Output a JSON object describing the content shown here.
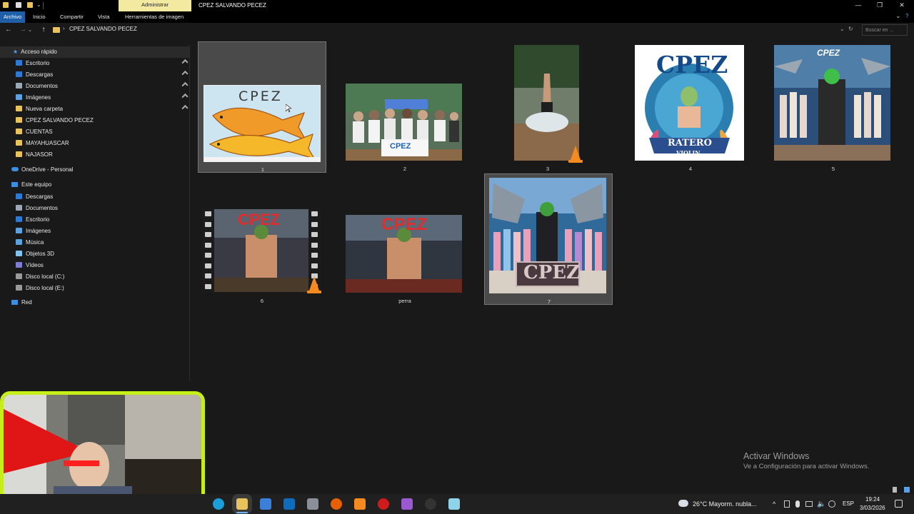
{
  "titlebar": {
    "contextual_tab": "Administrar",
    "window_title": "CPEZ SALVANDO PECEZ",
    "minimize": "—",
    "maximize": "❐",
    "close": "✕"
  },
  "ribbon": {
    "tabs": [
      {
        "label": "Archivo",
        "active": true
      },
      {
        "label": "Inicio"
      },
      {
        "label": "Compartir"
      },
      {
        "label": "Vista"
      },
      {
        "label": "Herramientas de imagen"
      }
    ],
    "expand": "⌄",
    "help": "?"
  },
  "addressbar": {
    "back": "←",
    "forward": "→",
    "recent": "⌄",
    "up": "↑",
    "chevron": "›",
    "path": "CPEZ SALVANDO PECEZ",
    "dropdown": "⌄",
    "refresh": "↻",
    "search_placeholder": "Buscar en ..."
  },
  "sidebar": {
    "quick_access": "Acceso rápido",
    "quick_items": [
      {
        "label": "Escritorio",
        "pinned": true,
        "color": "#2b7bd6"
      },
      {
        "label": "Descargas",
        "pinned": true,
        "color": "#2b7bd6"
      },
      {
        "label": "Documentos",
        "pinned": true,
        "color": "#9aa8b8"
      },
      {
        "label": "Imágenes",
        "pinned": true,
        "color": "#5ba3e0"
      },
      {
        "label": "Nueva carpeta",
        "pinned": true,
        "color": "#e8c25a"
      },
      {
        "label": "CPEZ SALVANDO PECEZ",
        "color": "#e8c25a"
      },
      {
        "label": "CUENTAS",
        "color": "#e8c25a"
      },
      {
        "label": "MAYAHUASCAR",
        "color": "#e8c25a"
      },
      {
        "label": "NAJASOR",
        "color": "#e8c25a"
      }
    ],
    "pin_glyph": "📌",
    "onedrive": "OneDrive - Personal",
    "this_pc": "Este equipo",
    "pc_items": [
      {
        "label": "Descargas",
        "color": "#2b7bd6"
      },
      {
        "label": "Documentos",
        "color": "#9aa8b8"
      },
      {
        "label": "Escritorio",
        "color": "#2b7bd6"
      },
      {
        "label": "Imágenes",
        "color": "#5ba3e0"
      },
      {
        "label": "Música",
        "color": "#5ba3e0"
      },
      {
        "label": "Objetos 3D",
        "color": "#7fc3f0"
      },
      {
        "label": "Vídeos",
        "color": "#7d7dd6"
      },
      {
        "label": "Disco local (C:)",
        "color": "#999999"
      },
      {
        "label": "Disco local (E:)",
        "color": "#999999"
      }
    ],
    "network": "Red"
  },
  "files": [
    {
      "label": "1",
      "kind": "drawing",
      "selected": true
    },
    {
      "label": "2",
      "kind": "photo-group"
    },
    {
      "label": "3",
      "kind": "video",
      "vlc": true
    },
    {
      "label": "4",
      "kind": "poster",
      "texts": [
        "CPEZ",
        "RATERO",
        "VIOLIN"
      ]
    },
    {
      "label": "5",
      "kind": "poster-sharks",
      "texts": [
        "CPEZ"
      ]
    },
    {
      "label": "6",
      "kind": "video-film",
      "vlc": true,
      "texts": [
        "CPEZ"
      ]
    },
    {
      "label": "perra",
      "kind": "poster-muscle",
      "texts": [
        "CPEZ"
      ]
    },
    {
      "label": "7",
      "kind": "poster-wedding",
      "selected": true,
      "texts": [
        "CPEZ"
      ]
    }
  ],
  "drawing_text": "CPEZ",
  "banner_text": "CPEZ",
  "watermark": {
    "line1": "Activar Windows",
    "line2": "Ve a Configuración para activar Windows."
  },
  "taskbar": {
    "weather": "26°C  Mayorm. nubla...",
    "language": "ESP",
    "time": "19:24",
    "date": "3/03/2026",
    "tray_arrow": "^",
    "icons": [
      {
        "name": "edge",
        "color": "#1a9fd9"
      },
      {
        "name": "file-explorer",
        "color": "#e8c25a",
        "active": true
      },
      {
        "name": "store",
        "color": "#3b7fd9"
      },
      {
        "name": "outlook",
        "color": "#0f6cbd"
      },
      {
        "name": "app",
        "color": "#8a8f99"
      },
      {
        "name": "firefox",
        "color": "#e66000"
      },
      {
        "name": "vlc",
        "color": "#f58b1f"
      },
      {
        "name": "opera",
        "color": "#d01b1b"
      },
      {
        "name": "messenger",
        "color": "#9b59d0"
      },
      {
        "name": "obs",
        "color": "#333333"
      },
      {
        "name": "notepad",
        "color": "#8fd3e8"
      }
    ]
  }
}
